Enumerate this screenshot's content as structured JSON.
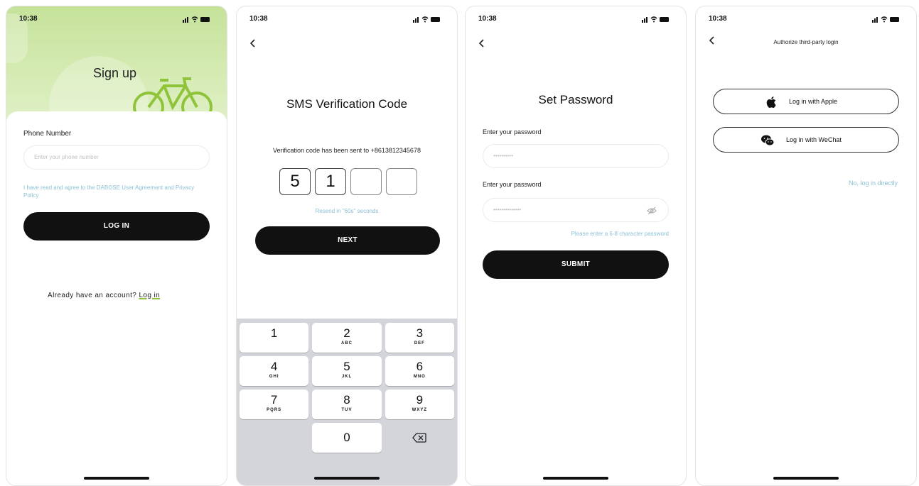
{
  "status": {
    "time": "10:38"
  },
  "screen1": {
    "title": "Sign up",
    "phone_label": "Phone Number",
    "phone_placeholder": "Enter your phone number",
    "agreement": "I have read and agree to the DABOSE User Agreement and Privacy Policy",
    "login_button": "LOG IN",
    "already_text": "Already have an account?",
    "login_link": "Log in"
  },
  "screen2": {
    "title": "SMS Verification Code",
    "sent_text": "Verification code has been sent to +8613812345678",
    "code": [
      "5",
      "1",
      "",
      ""
    ],
    "resend_text": "Resend in \"60s\" seconds",
    "next_button": "NEXT",
    "keypad": [
      {
        "num": "1",
        "letters": ""
      },
      {
        "num": "2",
        "letters": "ABC"
      },
      {
        "num": "3",
        "letters": "DEF"
      },
      {
        "num": "4",
        "letters": "GHI"
      },
      {
        "num": "5",
        "letters": "JKL"
      },
      {
        "num": "6",
        "letters": "MNO"
      },
      {
        "num": "7",
        "letters": "PQRS"
      },
      {
        "num": "8",
        "letters": "TUV"
      },
      {
        "num": "9",
        "letters": "WXYZ"
      },
      {
        "num": "0",
        "letters": ""
      }
    ]
  },
  "screen3": {
    "title": "Set Password",
    "label1": "Enter your password",
    "value1": "••••••••••",
    "label2": "Enter your password",
    "value2": "••••••••••••••",
    "hint": "Please enter a 6-8 character password",
    "submit_button": "SUBMIT"
  },
  "screen4": {
    "title": "Authorize third-party login",
    "apple_button": "Log in with Apple",
    "wechat_button": "Log in with WeChat",
    "skip_link": "No, log in directly"
  },
  "colors": {
    "accent_green": "#c5e29a",
    "link_blue": "#8bbfd4",
    "button_dark": "#111111",
    "keypad_bg": "#d3d5da"
  }
}
